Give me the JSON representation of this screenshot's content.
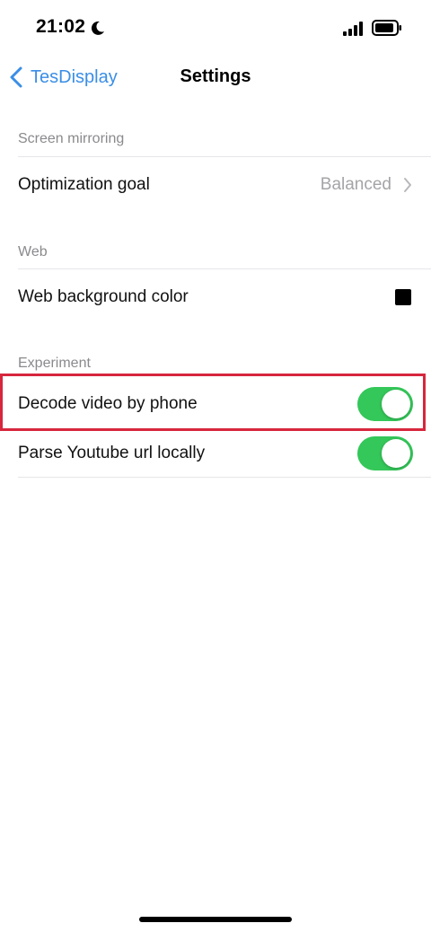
{
  "status_bar": {
    "time": "21:02",
    "moon_icon": "moon-icon",
    "signal_icon": "cellular-signal-icon",
    "battery_icon": "battery-icon"
  },
  "nav": {
    "back_label": "TesDisplay",
    "title": "Settings"
  },
  "sections": {
    "screen_mirroring": {
      "header": "Screen mirroring",
      "optimization_goal": {
        "label": "Optimization goal",
        "value": "Balanced"
      }
    },
    "web": {
      "header": "Web",
      "background_color": {
        "label": "Web background color",
        "color": "#000000"
      }
    },
    "experiment": {
      "header": "Experiment",
      "decode_video": {
        "label": "Decode video by phone",
        "on": true
      },
      "parse_youtube": {
        "label": "Parse Youtube url locally",
        "on": true
      }
    }
  },
  "colors": {
    "accent": "#3a8ee6",
    "toggle_on": "#34c759",
    "highlight": "#d7263d"
  }
}
